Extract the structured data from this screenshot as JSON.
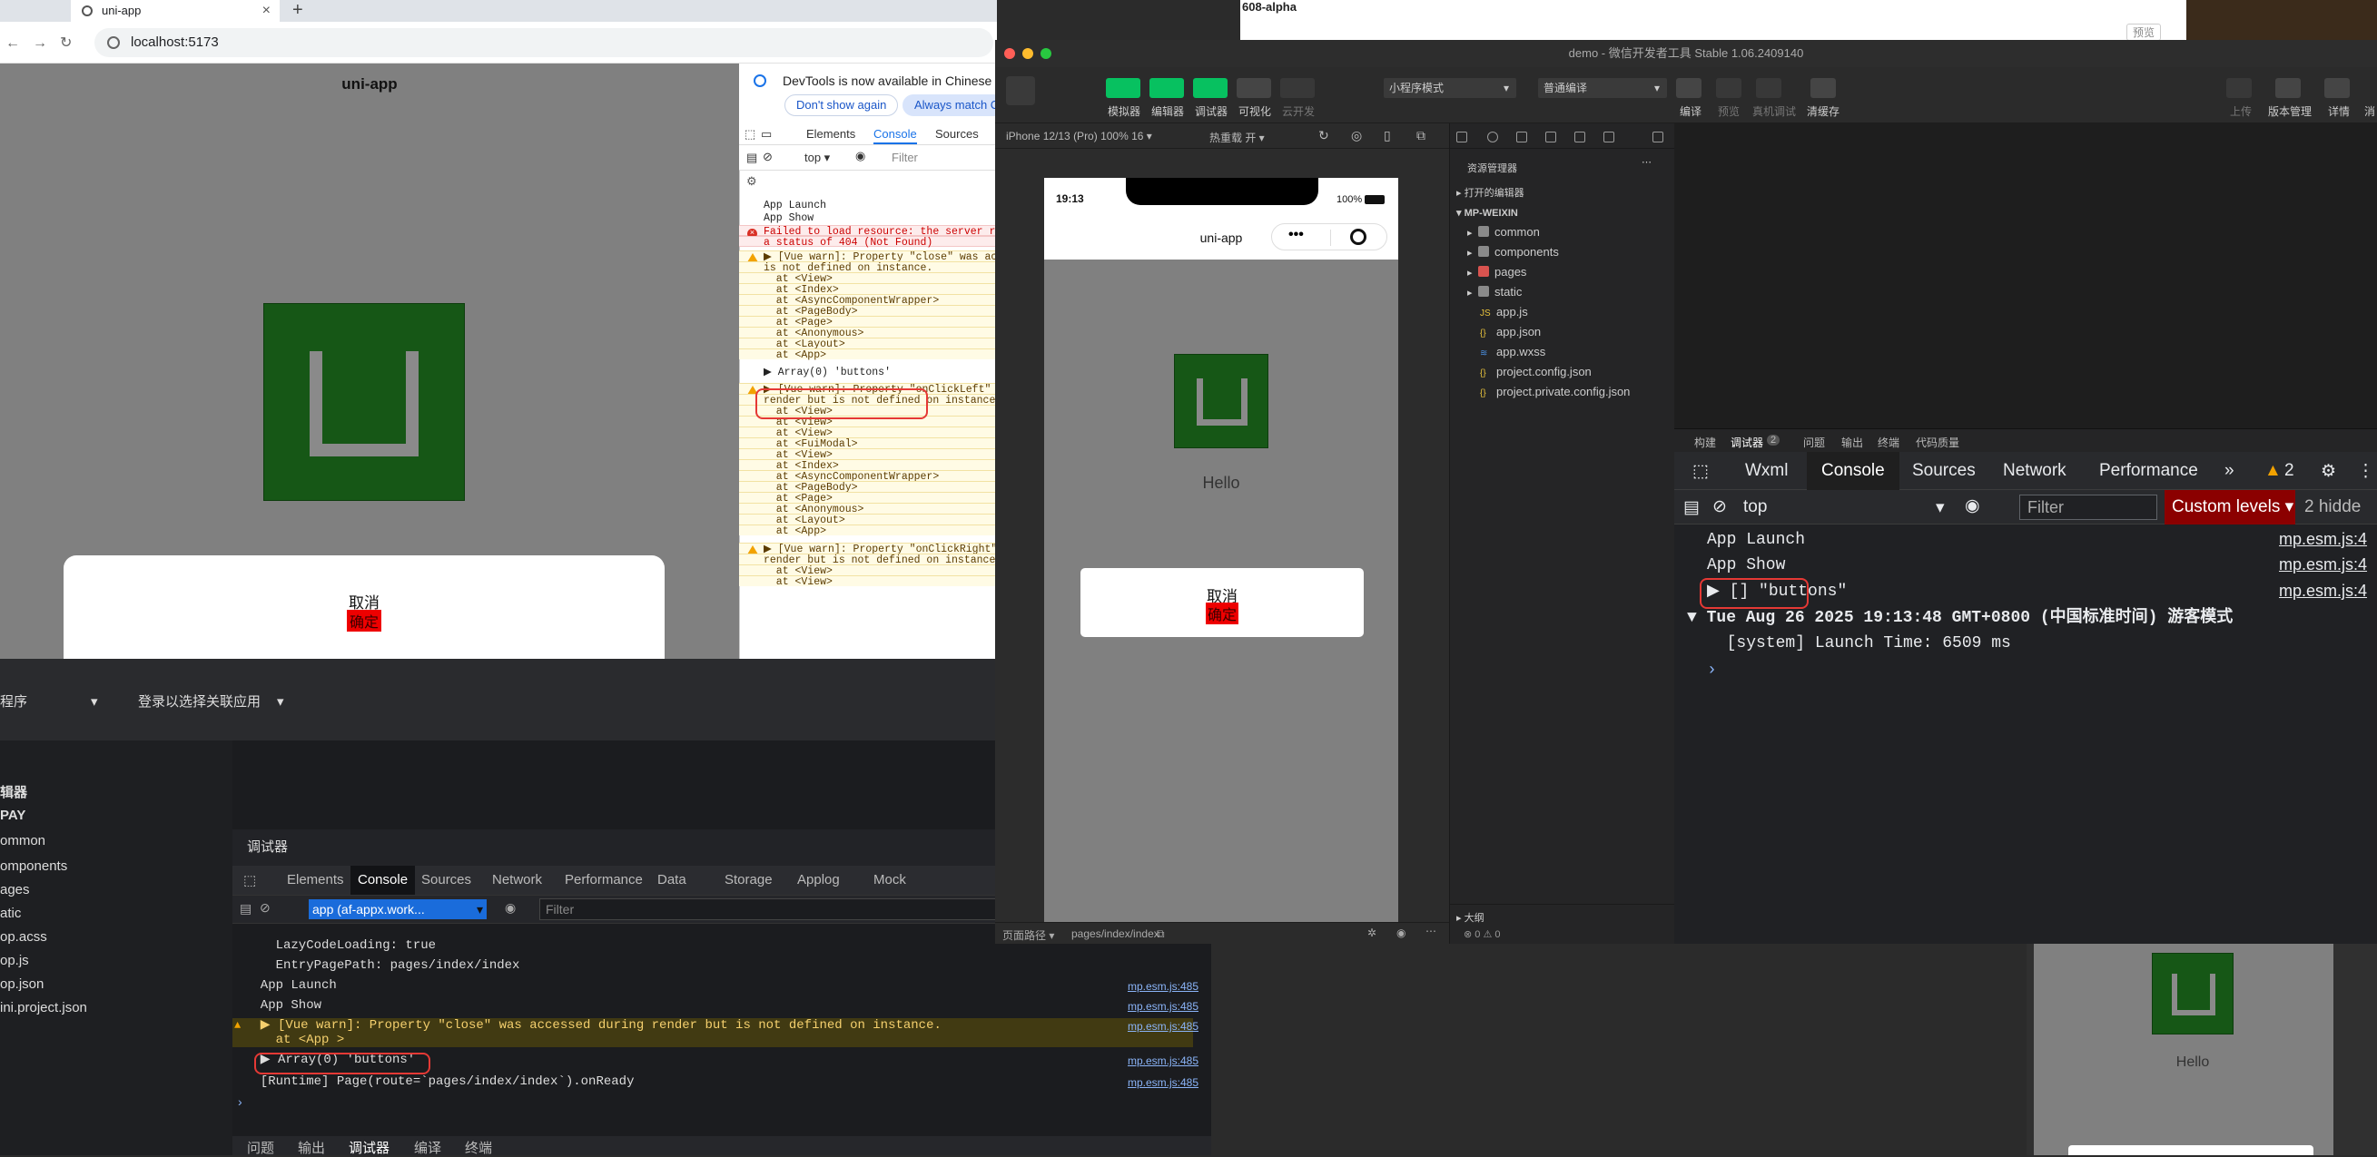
{
  "browser": {
    "tab_title": "uni-app",
    "url": "localhost:5173",
    "page_title": "uni-app",
    "modal": {
      "cancel": "取消",
      "confirm": "确定"
    },
    "devtools": {
      "notice": "DevTools is now available in Chinese",
      "btn_dont_show": "Don't show again",
      "btn_always_match": "Always match C",
      "tabs": [
        "Elements",
        "Console",
        "Sources"
      ],
      "context": "top ▾",
      "filter_placeholder": "Filter",
      "lines": [
        "App Launch",
        "App Show",
        "Failed to load resource: the server res",
        "a status of 404 (Not Found)",
        "▶ [Vue warn]: Property \"close\" was acce",
        "is not defined on instance.",
        "  at <View>",
        "  at <Index>",
        "  at <AsyncComponentWrapper>",
        "  at <PageBody>",
        "  at <Page>",
        "  at <Anonymous>",
        "  at <Layout>",
        "  at <App>",
        "▶ Array(0) 'buttons'",
        "▶ [Vue warn]: Property \"onClickLeft\" wa",
        "render but is not defined on instance.",
        "  at <View>",
        "  at <View>",
        "  at <View>",
        "  at <FuiModal>",
        "  at <View>",
        "  at <Index>",
        "  at <AsyncComponentWrapper>",
        "  at <PageBody>",
        "  at <Page>",
        "  at <Anonymous>",
        "  at <Layout>",
        "  at <App>",
        "▶ [Vue warn]: Property \"onClickRight\" w",
        "render but is not defined on instance.",
        "  at <View>",
        "  at <View>"
      ]
    }
  },
  "alipay": {
    "sel1": "程序",
    "sel2": "登录以选择关联应用",
    "tree": [
      "辑器",
      "PAY",
      "ommon",
      "omponents",
      "ages",
      "atic",
      "op.acss",
      "op.js",
      "op.json",
      "ini.project.json"
    ],
    "panel_title": "调试器",
    "tabs": [
      "Elements",
      "Console",
      "Sources",
      "Network",
      "Performance",
      "Data",
      "Storage",
      "Applog",
      "Mock"
    ],
    "context": "app (af-appx.work...",
    "filter_placeholder": "Filter",
    "console": [
      {
        "text": "    LazyCodeLoading: true",
        "src": ""
      },
      {
        "text": "    EntryPagePath: pages/index/index",
        "src": ""
      },
      {
        "text": "  App Launch",
        "src": "mp.esm.js:485"
      },
      {
        "text": "  App Show",
        "src": "mp.esm.js:485"
      },
      {
        "text": "  ▶ [Vue warn]: Property \"close\" was accessed during render but is not defined on instance.",
        "src": "mp.esm.js:485"
      },
      {
        "text": "    at <App >",
        "src": ""
      },
      {
        "text": "  ▶ Array(0) 'buttons'",
        "src": "mp.esm.js:485"
      },
      {
        "text": "  [Runtime] Page(route=`pages/index/index`).onReady",
        "src": "mp.esm.js:485"
      }
    ],
    "bottom_tabs": [
      "问题",
      "输出",
      "调试器",
      "编译",
      "终端"
    ]
  },
  "wechat": {
    "window_title": "demo - 微信开发者工具 Stable 1.06.2409140",
    "toolbar": {
      "buttons": [
        "模拟器",
        "编辑器",
        "调试器",
        "可视化",
        "云开发"
      ],
      "mode": "小程序模式",
      "compile": "普通编译",
      "actions": [
        "编译",
        "预览",
        "真机调试",
        "清缓存"
      ],
      "right": [
        "上传",
        "版本管理",
        "详情",
        "消"
      ]
    },
    "sim": {
      "device": "iPhone 12/13 (Pro) 100% 16 ▾",
      "hot_reload": "热重载 开 ▾",
      "time": "19:13",
      "battery": "100%",
      "title": "uni-app",
      "hello": "Hello",
      "cancel": "取消",
      "confirm": "确定",
      "footer_path_label": "页面路径 ▾",
      "footer_path": "pages/index/index"
    },
    "explorer": {
      "header": "资源管理器",
      "open_editors": "打开的编辑器",
      "project": "MP-WEIXIN",
      "folders": [
        "common",
        "components",
        "pages",
        "static"
      ],
      "files": [
        "app.js",
        "app.json",
        "app.wxss",
        "project.config.json",
        "project.private.config.json"
      ],
      "outline": "大纲",
      "status": "⊗ 0 ⚠ 0"
    },
    "debugger": {
      "top_tabs": [
        "构建",
        "调试器",
        "2",
        "问题",
        "输出",
        "终端",
        "代码质量"
      ],
      "tabs": [
        "Wxml",
        "Console",
        "Sources",
        "Network",
        "Performance",
        "»"
      ],
      "warn_count": "2",
      "context": "top",
      "filter_placeholder": "Filter",
      "levels": "Custom levels ▾",
      "hidden": "2 hidde",
      "console": [
        {
          "text": "App Launch",
          "src": "mp.esm.js:4"
        },
        {
          "text": "App Show",
          "src": "mp.esm.js:4"
        },
        {
          "text": "▶ [] \"buttons\"",
          "src": "mp.esm.js:4"
        },
        {
          "text": "▼ Tue Aug 26 2025 19:13:48 GMT+0800 (中国标准时间) 游客模式",
          "src": ""
        },
        {
          "text": "  [system] Launch Time: 6509 ms",
          "src": ""
        },
        {
          "text": "›",
          "src": ""
        }
      ]
    }
  },
  "background": {
    "top_label": "608-alpha",
    "preview": "预览",
    "hello": "Hello"
  },
  "colors": {
    "logo_green": "#165716",
    "wechat_green": "#07c160",
    "highlight_red": "#e53935"
  }
}
